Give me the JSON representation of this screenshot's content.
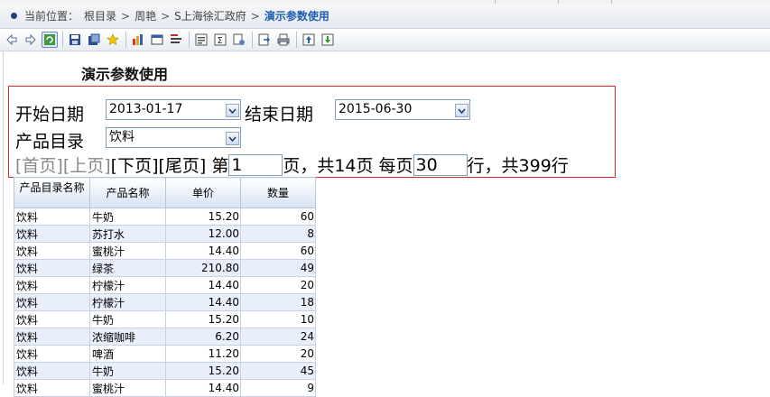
{
  "breadcrumb": {
    "prefix": "当前位置：",
    "items": [
      "根目录",
      "周艳",
      "S上海徐汇政府"
    ],
    "separator": ">",
    "current": "演示参数使用"
  },
  "toolbar": {
    "buttons": [
      "back-icon",
      "forward-icon",
      "refresh-icon",
      "save-icon",
      "save-as-icon",
      "favorite-star-icon",
      "chart-icon",
      "window-icon",
      "filter-icon",
      "params-icon",
      "sigma-icon",
      "settings-icon",
      "export-icon",
      "print-icon",
      "upload-icon",
      "download-icon"
    ]
  },
  "report": {
    "title": "演示参数使用",
    "params": {
      "start_label": "开始日期",
      "start_value": "2013-01-17",
      "end_label": "结束日期",
      "end_value": "2015-06-30",
      "category_label": "产品目录",
      "category_value": "饮料"
    },
    "pager": {
      "first": "[首页]",
      "prev": "[上页]",
      "next": "[下页]",
      "last": "[尾页]",
      "page_prefix": "第",
      "page_value": "1",
      "page_suffix": "页，共14页 每页",
      "rows_value": "30",
      "rows_suffix": "行，共399行"
    },
    "table": {
      "headers": [
        "产品目录名称",
        "产品名称",
        "单价",
        "数量"
      ],
      "rows": [
        [
          "饮料",
          "牛奶",
          "15.20",
          "60"
        ],
        [
          "饮料",
          "苏打水",
          "12.00",
          "8"
        ],
        [
          "饮料",
          "蜜桃汁",
          "14.40",
          "60"
        ],
        [
          "饮料",
          "绿茶",
          "210.80",
          "49"
        ],
        [
          "饮料",
          "柠檬汁",
          "14.40",
          "20"
        ],
        [
          "饮料",
          "柠檬汁",
          "14.40",
          "18"
        ],
        [
          "饮料",
          "牛奶",
          "15.20",
          "10"
        ],
        [
          "饮料",
          "浓缩咖啡",
          "6.20",
          "24"
        ],
        [
          "饮料",
          "啤酒",
          "11.20",
          "20"
        ],
        [
          "饮料",
          "牛奶",
          "15.20",
          "45"
        ],
        [
          "饮料",
          "蜜桃汁",
          "14.40",
          "9"
        ]
      ]
    }
  },
  "colors": {
    "param_border": "#e0262b",
    "header_bg": "#d6e3f3",
    "alt_row": "#e8eefa",
    "accent": "#1f5fb0"
  }
}
